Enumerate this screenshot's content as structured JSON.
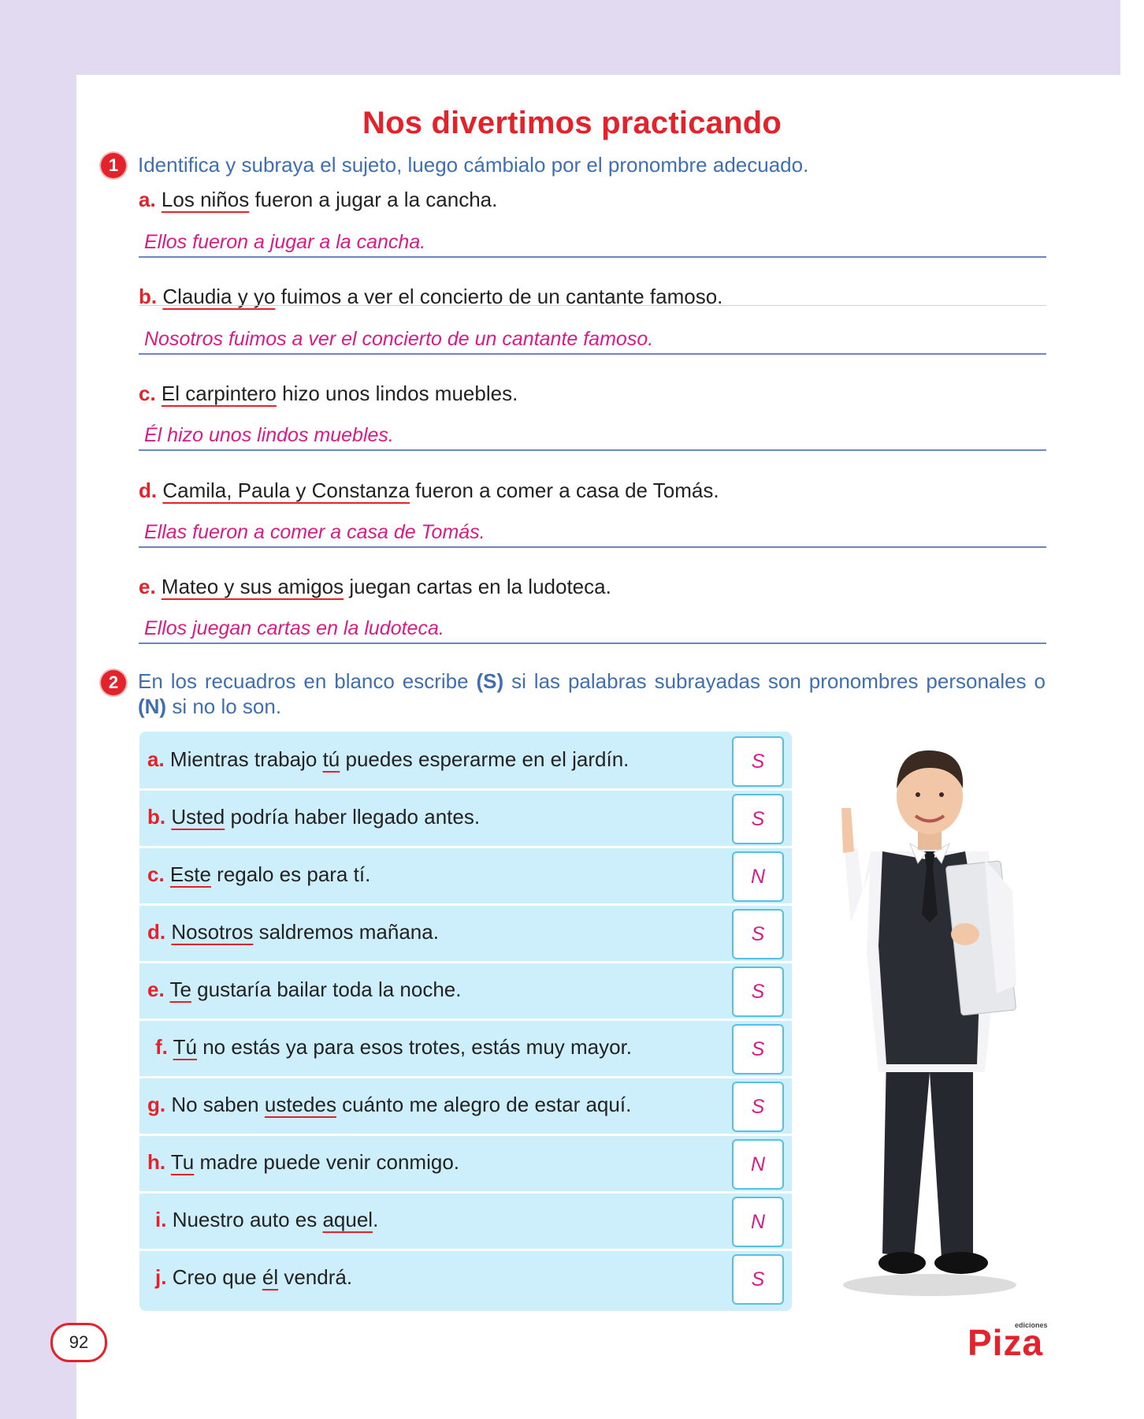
{
  "title": "Nos divertimos practicando",
  "exercise1": {
    "number": "1",
    "instruction": "Identifica y subraya el sujeto, luego cámbialo por el pronombre adecuado.",
    "items": [
      {
        "letter": "a.",
        "subject": "Los niños",
        "rest": " fueron a jugar a la cancha.",
        "answer": "Ellos fueron a jugar a la cancha."
      },
      {
        "letter": "b.",
        "subject": "Claudia y yo",
        "rest": " fuimos a ver el concierto de un cantante famoso.",
        "answer": "Nosotros fuimos a ver el concierto de un cantante famoso."
      },
      {
        "letter": "c.",
        "subject": "El carpintero",
        "rest": " hizo unos lindos muebles.",
        "answer": "Él hizo unos lindos muebles."
      },
      {
        "letter": "d.",
        "subject": "Camila, Paula y Constanza",
        "rest": " fueron a comer a casa de Tomás.",
        "answer": "Ellas fueron a comer a casa de Tomás."
      },
      {
        "letter": "e.",
        "subject": "Mateo y sus amigos",
        "rest": " juegan cartas en la ludoteca.",
        "answer": "Ellos juegan cartas en la ludoteca."
      }
    ]
  },
  "exercise2": {
    "number": "2",
    "instruction_a": "En los recuadros en blanco escribe ",
    "instruction_s": "(S)",
    "instruction_b": " si las palabras subrayadas son pronombres personales o ",
    "instruction_n": "(N)",
    "instruction_c": " si no lo son.",
    "rows": [
      {
        "letter": "a.",
        "pre": "Mientras trabajo ",
        "under": "tú",
        "post": " puedes esperarme en el jardín.",
        "answer": "S"
      },
      {
        "letter": "b.",
        "pre": "",
        "under": "Usted",
        "post": " podría haber llegado antes.",
        "answer": "S"
      },
      {
        "letter": "c.",
        "pre": "",
        "under": "Este",
        "post": " regalo es para tí.",
        "answer": "N"
      },
      {
        "letter": "d.",
        "pre": "",
        "under": "Nosotros",
        "post": " saldremos mañana.",
        "answer": "S"
      },
      {
        "letter": "e.",
        "pre": "",
        "under": "Te",
        "post": " gustaría bailar toda la noche.",
        "answer": "S"
      },
      {
        "letter": "f.",
        "pre": "",
        "under": "Tú",
        "post": " no estás ya para esos trotes, estás muy mayor.",
        "answer": "S"
      },
      {
        "letter": "g.",
        "pre": "No saben ",
        "under": "ustedes",
        "post": " cuánto me alegro de estar aquí.",
        "answer": "S"
      },
      {
        "letter": "h.",
        "pre": "",
        "under": "Tu",
        "post": " madre puede venir conmigo.",
        "answer": "N"
      },
      {
        "letter": "i.",
        "pre": "Nuestro auto es ",
        "under": "aquel",
        "post": ".",
        "answer": "N"
      },
      {
        "letter": "j.",
        "pre": "Creo que ",
        "under": "él",
        "post": " vendrá.",
        "answer": "S"
      }
    ]
  },
  "page_number": "92",
  "logo": {
    "small": "ediciones",
    "main": "Piza"
  },
  "colors": {
    "accent_red": "#e3232b",
    "instruction_blue": "#3f6fb0",
    "answer_magenta": "#d81b88",
    "table_bg": "#cdeffb",
    "band_lavender": "#e1daf0"
  }
}
